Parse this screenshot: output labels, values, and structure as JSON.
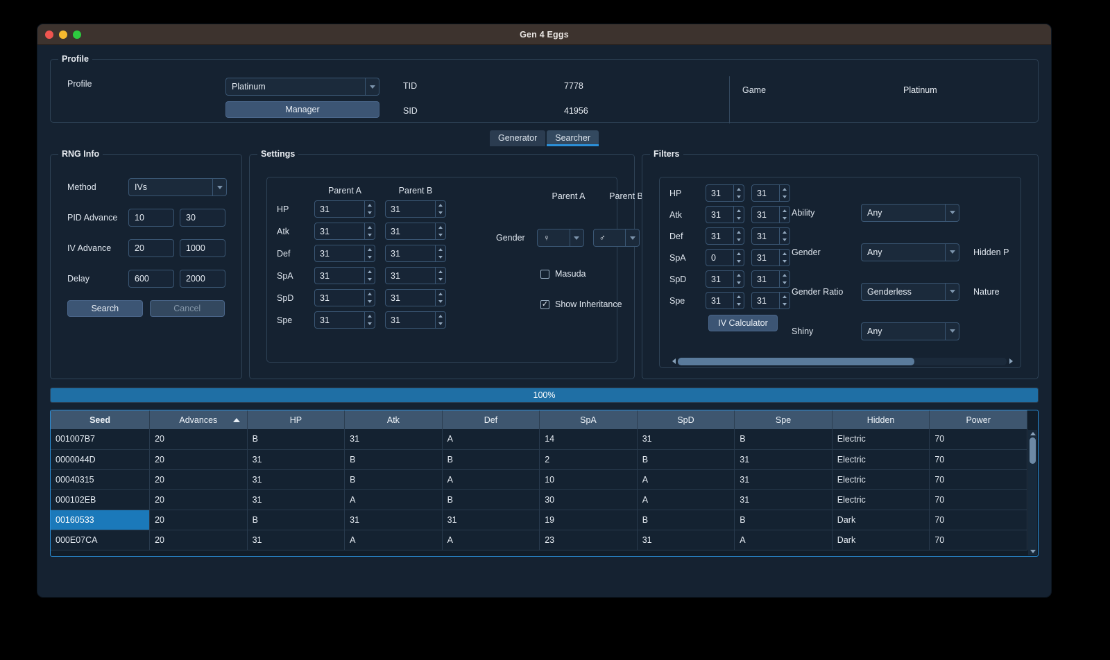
{
  "window": {
    "title": "Gen 4 Eggs"
  },
  "profile": {
    "legend": "Profile",
    "profile_label": "Profile",
    "profile_value": "Platinum",
    "manager_label": "Manager",
    "tid_label": "TID",
    "tid_value": "7778",
    "sid_label": "SID",
    "sid_value": "41956",
    "game_label": "Game",
    "game_value": "Platinum"
  },
  "tabs": [
    {
      "label": "Generator",
      "active": false
    },
    {
      "label": "Searcher",
      "active": true
    }
  ],
  "rng_info": {
    "legend": "RNG Info",
    "method_label": "Method",
    "method_value": "IVs",
    "pid_advance_label": "PID Advance",
    "pid_advance_min": "10",
    "pid_advance_max": "30",
    "iv_advance_label": "IV Advance",
    "iv_advance_min": "20",
    "iv_advance_max": "1000",
    "delay_label": "Delay",
    "delay_min": "600",
    "delay_max": "2000",
    "search_label": "Search",
    "cancel_label": "Cancel"
  },
  "settings": {
    "legend": "Settings",
    "parent_a_label": "Parent A",
    "parent_b_label": "Parent B",
    "stats": [
      "HP",
      "Atk",
      "Def",
      "SpA",
      "SpD",
      "Spe"
    ],
    "parent_a_ivs": [
      "31",
      "31",
      "31",
      "31",
      "31",
      "31"
    ],
    "parent_b_ivs": [
      "31",
      "31",
      "31",
      "31",
      "31",
      "31"
    ],
    "gender_parent_a_label": "Parent A",
    "gender_parent_b_label": "Parent B",
    "gender_label": "Gender",
    "gender_parent_a_value": "♀",
    "gender_parent_b_value": "♂",
    "masuda_label": "Masuda",
    "masuda_checked": false,
    "show_inheritance_label": "Show Inheritance",
    "show_inheritance_checked": true,
    "check_glyph": "✓"
  },
  "filters": {
    "legend": "Filters",
    "stats": [
      "HP",
      "Atk",
      "Def",
      "SpA",
      "SpD",
      "Spe"
    ],
    "min_ivs": [
      "31",
      "31",
      "31",
      "0",
      "31",
      "31"
    ],
    "max_ivs": [
      "31",
      "31",
      "31",
      "31",
      "31",
      "31"
    ],
    "iv_calculator_label": "IV Calculator",
    "ability_label": "Ability",
    "ability_value": "Any",
    "gender_label": "Gender",
    "gender_value": "Any",
    "gender_ratio_label": "Gender Ratio",
    "gender_ratio_value": "Genderless",
    "shiny_label": "Shiny",
    "shiny_value": "Any",
    "hidden_power_label": "Hidden P",
    "nature_label": "Nature"
  },
  "progress": {
    "percent_label": "100%",
    "value": 100
  },
  "results": {
    "columns": [
      "Seed",
      "Advances",
      "HP",
      "Atk",
      "Def",
      "SpA",
      "SpD",
      "Spe",
      "Hidden",
      "Power"
    ],
    "sorted_column": "Advances",
    "sort_direction": "ascending",
    "selected_row_index": 4,
    "rows": [
      [
        "001007B7",
        "20",
        "B",
        "31",
        "A",
        "14",
        "31",
        "B",
        "Electric",
        "70"
      ],
      [
        "0000044D",
        "20",
        "31",
        "B",
        "B",
        "2",
        "B",
        "31",
        "Electric",
        "70"
      ],
      [
        "00040315",
        "20",
        "31",
        "B",
        "A",
        "10",
        "A",
        "31",
        "Electric",
        "70"
      ],
      [
        "000102EB",
        "20",
        "31",
        "A",
        "B",
        "30",
        "A",
        "31",
        "Electric",
        "70"
      ],
      [
        "00160533",
        "20",
        "B",
        "31",
        "31",
        "19",
        "B",
        "B",
        "Dark",
        "70"
      ],
      [
        "000E07CA",
        "20",
        "31",
        "A",
        "A",
        "23",
        "31",
        "A",
        "Dark",
        "70"
      ]
    ]
  },
  "colors": {
    "accent": "#2b90d9",
    "titlebar": "#3d332e",
    "window_bg": "#152231",
    "selection": "#1b79ba",
    "button": "#3c5574"
  }
}
